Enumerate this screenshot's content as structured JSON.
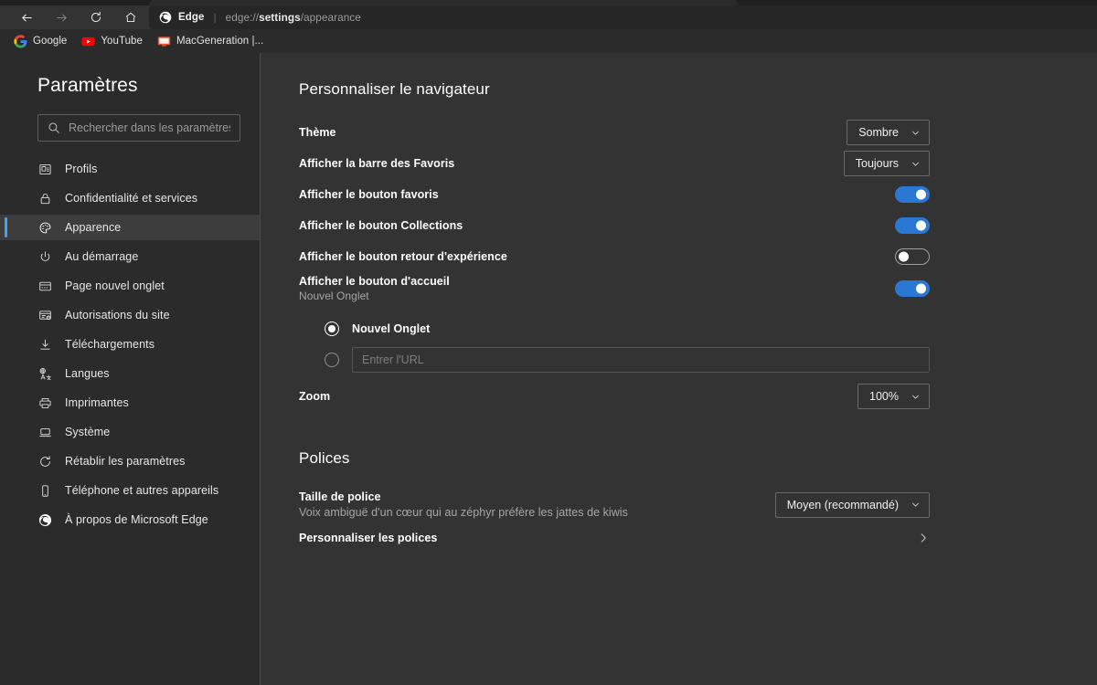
{
  "browser": {
    "nav": {
      "back": "back-arrow",
      "forward": "forward-arrow",
      "reload": "reload",
      "home": "home"
    },
    "omnibox": {
      "brand": "Edge",
      "separator": "|",
      "url_prefix": "edge://",
      "url_bold": "settings",
      "url_suffix": "/appearance",
      "full_url": "edge://settings/appearance"
    },
    "bookmarks": [
      {
        "label": "Google",
        "icon": "google-icon"
      },
      {
        "label": "YouTube",
        "icon": "youtube-icon"
      },
      {
        "label": "MacGeneration |...",
        "icon": "macgeneration-icon"
      }
    ]
  },
  "sidebar": {
    "title": "Paramètres",
    "search_placeholder": "Rechercher dans les paramètres",
    "search_value": "",
    "items": [
      {
        "label": "Profils",
        "icon": "profile-card-icon",
        "selected": false
      },
      {
        "label": "Confidentialité et services",
        "icon": "lock-icon",
        "selected": false
      },
      {
        "label": "Apparence",
        "icon": "palette-icon",
        "selected": true
      },
      {
        "label": "Au démarrage",
        "icon": "power-icon",
        "selected": false
      },
      {
        "label": "Page nouvel onglet",
        "icon": "new-tab-page-icon",
        "selected": false
      },
      {
        "label": "Autorisations du site",
        "icon": "site-permissions-icon",
        "selected": false
      },
      {
        "label": "Téléchargements",
        "icon": "download-icon",
        "selected": false
      },
      {
        "label": "Langues",
        "icon": "languages-icon",
        "selected": false
      },
      {
        "label": "Imprimantes",
        "icon": "printer-icon",
        "selected": false
      },
      {
        "label": "Système",
        "icon": "system-icon",
        "selected": false
      },
      {
        "label": "Rétablir les paramètres",
        "icon": "reset-icon",
        "selected": false
      },
      {
        "label": "Téléphone et autres appareils",
        "icon": "phone-icon",
        "selected": false
      },
      {
        "label": "À propos de Microsoft Edge",
        "icon": "edge-logo-icon",
        "selected": false
      }
    ]
  },
  "main": {
    "customize_heading": "Personnaliser le navigateur",
    "theme": {
      "label": "Thème",
      "value": "Sombre"
    },
    "favorites_bar": {
      "label": "Afficher la barre des Favoris",
      "value": "Toujours"
    },
    "favorites_button": {
      "label": "Afficher le bouton favoris",
      "state": "on"
    },
    "collections_button": {
      "label": "Afficher le bouton Collections",
      "state": "on"
    },
    "feedback_button": {
      "label": "Afficher le bouton retour d'expérience",
      "state": "off"
    },
    "home_button": {
      "label": "Afficher le bouton d'accueil",
      "sub": "Nouvel Onglet",
      "state": "on",
      "radio_new_tab": "Nouvel Onglet",
      "radio_new_tab_checked": true,
      "url_placeholder": "Entrer l'URL",
      "url_value": "",
      "radio_url_checked": false
    },
    "zoom": {
      "label": "Zoom",
      "value": "100%"
    },
    "fonts_heading": "Polices",
    "font_size": {
      "label": "Taille de police",
      "value": "Moyen (recommandé)",
      "sample": "Voix ambiguë d'un cœur qui au zéphyr préfère les jattes de kiwis"
    },
    "customize_fonts": {
      "label": "Personnaliser les polices",
      "chevron": "chevron-right-icon"
    }
  },
  "colors": {
    "toolbar_bg": "#333333",
    "tabstrip_bg": "#202020",
    "omnibox_bg": "#262626",
    "bookmarks_bg": "#2b2b2b",
    "sidebar_bg": "#2b2b2b",
    "content_bg": "#333333",
    "accent_blue": "#4aa3f0",
    "toggle_on": "#2b78d4",
    "selected_item_bg": "#3d3d3d"
  }
}
